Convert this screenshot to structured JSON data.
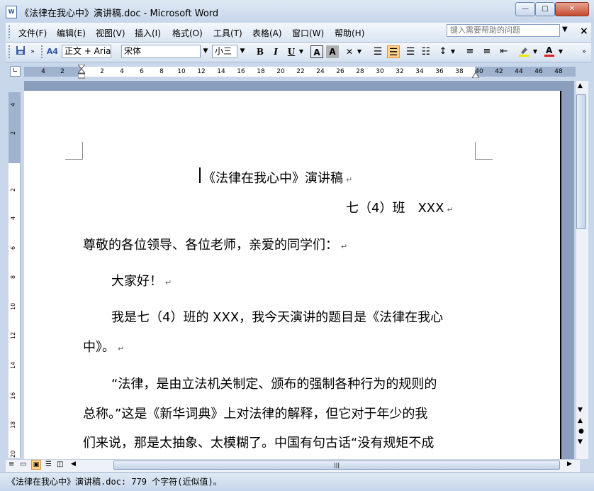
{
  "window": {
    "title": "《法律在我心中》演讲稿.doc - Microsoft Word",
    "app_icon": "W",
    "min": "—",
    "max": "□",
    "close": "✕"
  },
  "menu": {
    "items": [
      "文件(F)",
      "编辑(E)",
      "视图(V)",
      "插入(I)",
      "格式(O)",
      "工具(T)",
      "表格(A)",
      "窗口(W)",
      "帮助(H)"
    ],
    "help_placeholder": "键入需要帮助的问题",
    "close_doc": "×"
  },
  "toolbar": {
    "style_value": "正文 + Aria",
    "font_value": "宋体",
    "size_value": "小三",
    "bold": "B",
    "italic": "I",
    "underline": "U",
    "char_border": "A",
    "char_shading": "A",
    "style_icon": "A4",
    "accent_active": "#ffd38a",
    "font_color": "#e02020",
    "highlight_color": "#f5e600"
  },
  "ruler": {
    "h_ticks": [
      "4",
      "2",
      "2",
      "4",
      "6",
      "8",
      "10",
      "12",
      "14",
      "16",
      "18",
      "20",
      "22",
      "24",
      "26",
      "28",
      "30",
      "32",
      "34",
      "36",
      "38",
      "40",
      "42",
      "44",
      "46",
      "48"
    ],
    "v_ticks": [
      "4",
      "2",
      "2",
      "4",
      "6",
      "8",
      "10",
      "12",
      "14",
      "16",
      "18",
      "20"
    ]
  },
  "document": {
    "title": "《法律在我心中》演讲稿",
    "class_line": "七（4）班　XXX",
    "salutation": "尊敬的各位领导、各位老师，亲爱的同学们：",
    "greeting": "大家好！",
    "para1_line1": "我是七（4）班的 XXX，我今天演讲的题目是《法律在我心",
    "para1_line2": "中》。",
    "para2_line1": "“法律，是由立法机关制定、颁布的强制各种行为的规则的",
    "para2_line2": "总称。”这是《新华词典》上对法律的解释，但它对于年少的我",
    "para2_line3": "们来说，那是太抽象、太模糊了。中国有句古话“没有规矩不成",
    "paragraph_mark": "↵"
  },
  "status": {
    "text": "《法律在我心中》演讲稿.doc: 779 个字符(近似值)。"
  }
}
